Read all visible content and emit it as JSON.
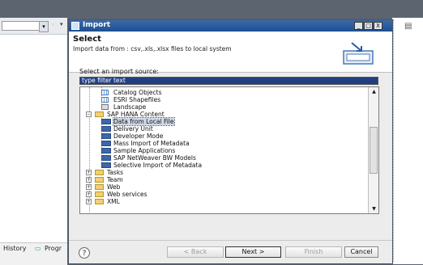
{
  "background": {
    "bottom_tabs": [
      "History",
      "Progr"
    ]
  },
  "dialog": {
    "title": "Import",
    "window_buttons": [
      "_",
      "□",
      "X"
    ],
    "banner": {
      "title": "Select",
      "description": "Import data from : csv,.xls,.xlsx files to local system"
    },
    "source_label": "Select an import source:",
    "filter": {
      "value": "type filter text"
    },
    "tree": [
      {
        "label": "Catalog Objects",
        "icon": "table-icon"
      },
      {
        "label": "ESRI Shapefiles",
        "icon": "table-icon"
      },
      {
        "label": "Landscape",
        "icon": "landscape-icon"
      },
      {
        "label": "SAP HANA Content",
        "icon": "folder-icon",
        "expanded": true
      },
      {
        "label": "Data from Local File",
        "icon": "import-icon",
        "selected": true
      },
      {
        "label": "Delivery Unit",
        "icon": "import-icon"
      },
      {
        "label": "Developer Mode",
        "icon": "import-icon"
      },
      {
        "label": "Mass Import of Metadata",
        "icon": "import-icon"
      },
      {
        "label": "Sample Applications",
        "icon": "import-icon"
      },
      {
        "label": "SAP NetWeaver BW Models",
        "icon": "import-icon"
      },
      {
        "label": "Selective Import of Metadata",
        "icon": "import-icon"
      },
      {
        "label": "Tasks",
        "icon": "folder-icon",
        "expanded": false
      },
      {
        "label": "Team",
        "icon": "folder-icon",
        "expanded": false
      },
      {
        "label": "Web",
        "icon": "folder-icon",
        "expanded": false
      },
      {
        "label": "Web services",
        "icon": "folder-icon",
        "expanded": false
      },
      {
        "label": "XML",
        "icon": "folder-icon",
        "expanded": false
      }
    ],
    "buttons": {
      "help": "?",
      "back": "< Back",
      "next": "Next >",
      "finish": "Finish",
      "cancel": "Cancel"
    }
  }
}
